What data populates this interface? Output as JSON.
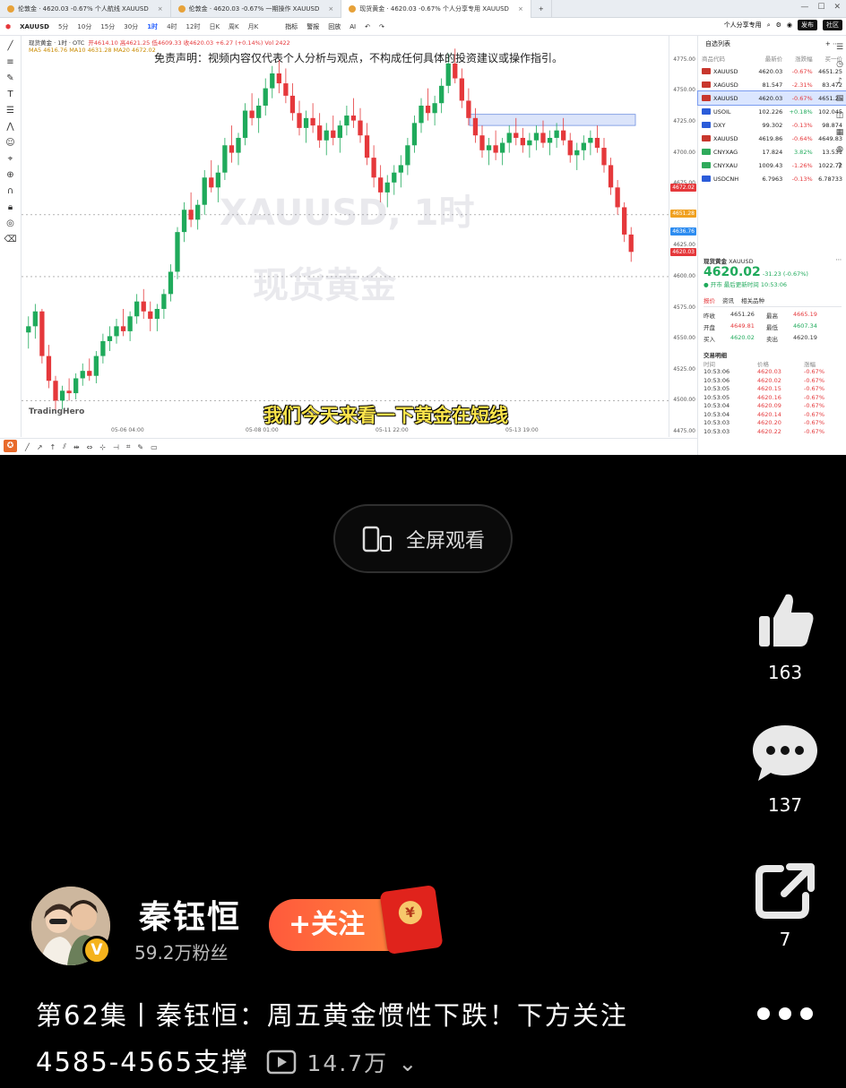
{
  "tabs": [
    {
      "label": "伦敦金 · 4620.03 -0.67% 个人航线 XAUUSD",
      "active": false
    },
    {
      "label": "伦敦金 · 4620.03 -0.67% 一期操作 XAUUSD",
      "active": false
    },
    {
      "label": "现货黄金 · 4620.03 -0.67% 个人分享专用 XAUUSD",
      "active": true
    }
  ],
  "toolbar": {
    "symbol": "XAUUSD",
    "timeframes": [
      "5分",
      "10分",
      "15分",
      "30分",
      "1时",
      "4时",
      "12时",
      "日K",
      "周K",
      "月K"
    ],
    "active_timeframe": "1时",
    "tools": [
      "指标",
      "警报",
      "回放",
      "AI"
    ],
    "right_label": "个人分享专用",
    "btn_publish": "发布",
    "btn_community": "社区"
  },
  "chart": {
    "info_line": "现货黄金 · 1时 · OTC",
    "ohlc": "开4614.10 高4621.25 低4609.33 收4620.03 +6.27 (+0.14%)  Vol 2422",
    "ma_line": "MA5 4616.76  MA10 4631.28  MA20 4672.02",
    "disclaimer": "免责声明：视频内容仅代表个人分析与观点，不构成任何具体的投资建议或操作指引。",
    "watermark_symbol": "XAUUSD, 1时",
    "watermark_name": "现货黄金",
    "logo": "TradingHero",
    "subtitle": "我们今天来看一下黄金在短线",
    "price_ticks": [
      "4775.00",
      "4750.00",
      "4725.00",
      "4700.00",
      "4675.00",
      "4650.00",
      "4625.00",
      "4600.00",
      "4575.00",
      "4550.00",
      "4525.00",
      "4500.00",
      "4475.00"
    ],
    "price_tags": [
      {
        "label": "4672.02",
        "color": "#e5383b"
      },
      {
        "label": "4651.28",
        "color": "#f0a020"
      },
      {
        "label": "4636.76",
        "color": "#2d8cf0"
      },
      {
        "label": "4620.03",
        "color": "#e5383b"
      }
    ],
    "x_labels": [
      "05-06 04:00",
      "05-08 01:00",
      "05-11 22:00",
      "05-13 19:00"
    ],
    "chart_data": {
      "type": "candlestick",
      "series": [
        {
          "name": "XAUUSD",
          "values": [
            [
              4555,
              4568,
              4542,
              4560
            ],
            [
              4560,
              4578,
              4550,
              4572
            ],
            [
              4572,
              4574,
              4530,
              4536
            ],
            [
              4536,
              4545,
              4510,
              4516
            ],
            [
              4516,
              4520,
              4492,
              4500
            ],
            [
              4500,
              4512,
              4493,
              4508
            ],
            [
              4508,
              4518,
              4500,
              4506
            ],
            [
              4506,
              4522,
              4501,
              4518
            ],
            [
              4518,
              4530,
              4512,
              4524
            ],
            [
              4524,
              4534,
              4516,
              4520
            ],
            [
              4520,
              4540,
              4514,
              4536
            ],
            [
              4536,
              4554,
              4530,
              4548
            ],
            [
              4548,
              4560,
              4540,
              4552
            ],
            [
              4552,
              4566,
              4546,
              4560
            ],
            [
              4560,
              4574,
              4552,
              4556
            ],
            [
              4556,
              4572,
              4548,
              4568
            ],
            [
              4568,
              4586,
              4562,
              4580
            ],
            [
              4580,
              4590,
              4566,
              4572
            ],
            [
              4572,
              4580,
              4556,
              4566
            ],
            [
              4566,
              4578,
              4556,
              4574
            ],
            [
              4574,
              4590,
              4566,
              4586
            ],
            [
              4586,
              4610,
              4580,
              4604
            ],
            [
              4604,
              4640,
              4598,
              4636
            ],
            [
              4636,
              4660,
              4628,
              4654
            ],
            [
              4654,
              4668,
              4640,
              4646
            ],
            [
              4646,
              4662,
              4638,
              4658
            ],
            [
              4658,
              4686,
              4650,
              4680
            ],
            [
              4680,
              4694,
              4668,
              4672
            ],
            [
              4672,
              4690,
              4660,
              4684
            ],
            [
              4684,
              4712,
              4678,
              4706
            ],
            [
              4706,
              4722,
              4692,
              4700
            ],
            [
              4700,
              4716,
              4690,
              4712
            ],
            [
              4712,
              4740,
              4706,
              4734
            ],
            [
              4734,
              4748,
              4722,
              4728
            ],
            [
              4728,
              4744,
              4716,
              4738
            ],
            [
              4738,
              4760,
              4730,
              4752
            ],
            [
              4752,
              4770,
              4744,
              4764
            ],
            [
              4764,
              4775,
              4748,
              4756
            ],
            [
              4756,
              4768,
              4740,
              4746
            ],
            [
              4746,
              4756,
              4726,
              4732
            ],
            [
              4732,
              4742,
              4714,
              4720
            ],
            [
              4720,
              4734,
              4708,
              4728
            ],
            [
              4728,
              4740,
              4716,
              4722
            ],
            [
              4722,
              4732,
              4704,
              4710
            ],
            [
              4710,
              4724,
              4698,
              4718
            ],
            [
              4718,
              4730,
              4706,
              4712
            ],
            [
              4712,
              4726,
              4700,
              4722
            ],
            [
              4722,
              4738,
              4714,
              4730
            ],
            [
              4730,
              4744,
              4720,
              4726
            ],
            [
              4726,
              4736,
              4708,
              4714
            ],
            [
              4714,
              4724,
              4690,
              4696
            ],
            [
              4696,
              4706,
              4672,
              4680
            ],
            [
              4680,
              4690,
              4660,
              4668
            ],
            [
              4668,
              4682,
              4656,
              4676
            ],
            [
              4676,
              4690,
              4666,
              4684
            ],
            [
              4684,
              4698,
              4672,
              4690
            ],
            [
              4690,
              4712,
              4682,
              4706
            ],
            [
              4706,
              4730,
              4700,
              4724
            ],
            [
              4724,
              4744,
              4716,
              4738
            ],
            [
              4738,
              4752,
              4726,
              4732
            ],
            [
              4732,
              4746,
              4722,
              4740
            ],
            [
              4740,
              4760,
              4732,
              4754
            ],
            [
              4754,
              4780,
              4748,
              4772
            ],
            [
              4772,
              4784,
              4756,
              4760
            ],
            [
              4760,
              4768,
              4736,
              4742
            ],
            [
              4742,
              4752,
              4722,
              4728
            ],
            [
              4728,
              4736,
              4708,
              4714
            ],
            [
              4714,
              4722,
              4696,
              4702
            ],
            [
              4702,
              4712,
              4690,
              4706
            ],
            [
              4706,
              4718,
              4694,
              4700
            ],
            [
              4700,
              4712,
              4690,
              4708
            ],
            [
              4708,
              4722,
              4700,
              4716
            ],
            [
              4716,
              4728,
              4706,
              4712
            ],
            [
              4712,
              4720,
              4700,
              4706
            ],
            [
              4706,
              4716,
              4696,
              4710
            ],
            [
              4710,
              4722,
              4702,
              4716
            ],
            [
              4716,
              4726,
              4704,
              4708
            ],
            [
              4708,
              4718,
              4698,
              4712
            ],
            [
              4712,
              4724,
              4704,
              4718
            ],
            [
              4718,
              4728,
              4706,
              4710
            ],
            [
              4710,
              4716,
              4692,
              4698
            ],
            [
              4698,
              4708,
              4686,
              4702
            ],
            [
              4702,
              4714,
              4694,
              4708
            ],
            [
              4708,
              4718,
              4698,
              4712
            ],
            [
              4712,
              4722,
              4700,
              4704
            ],
            [
              4704,
              4712,
              4684,
              4690
            ],
            [
              4690,
              4696,
              4666,
              4672
            ],
            [
              4672,
              4678,
              4650,
              4656
            ],
            [
              4656,
              4660,
              4628,
              4634
            ],
            [
              4634,
              4640,
              4612,
              4620
            ]
          ]
        }
      ],
      "ylim": [
        4475,
        4790
      ],
      "zone": [
        4722,
        4731
      ]
    }
  },
  "watchlist": {
    "title": "自选列表",
    "columns": [
      "商品代码",
      "最新价",
      "涨跌幅",
      "买一价"
    ],
    "rows": [
      {
        "code": "XAUUSD",
        "price": "4620.03",
        "chg": "-0.67%",
        "bid": "4651.25",
        "flag": "#c8372d",
        "neg": true,
        "sel": false
      },
      {
        "code": "XAGUSD",
        "price": "81.547",
        "chg": "-2.31%",
        "bid": "83.472",
        "flag": "#c8372d",
        "neg": true,
        "sel": false
      },
      {
        "code": "XAUUSD",
        "price": "4620.03",
        "chg": "-0.67%",
        "bid": "4651.25",
        "flag": "#c8372d",
        "neg": true,
        "sel": true
      },
      {
        "code": "USOIL",
        "price": "102.226",
        "chg": "+0.18%",
        "bid": "102.045",
        "flag": "#2b5cd9",
        "neg": false,
        "sel": false
      },
      {
        "code": "DXY",
        "price": "99.302",
        "chg": "-0.13%",
        "bid": "98.874",
        "flag": "#2b5cd9",
        "neg": true,
        "sel": false
      },
      {
        "code": "XAUUSD",
        "price": "4619.86",
        "chg": "-0.64%",
        "bid": "4649.83",
        "flag": "#c8372d",
        "neg": true,
        "sel": false
      },
      {
        "code": "CNYXAG",
        "price": "17.824",
        "chg": "3.82%",
        "bid": "13.531",
        "flag": "#2faa5b",
        "neg": false,
        "sel": false
      },
      {
        "code": "CNYXAU",
        "price": "1009.43",
        "chg": "-1.26%",
        "bid": "1022.72",
        "flag": "#2faa5b",
        "neg": true,
        "sel": false
      },
      {
        "code": "USDCNH",
        "price": "6.7963",
        "chg": "-0.13%",
        "bid": "6.78733",
        "flag": "#2b5cd9",
        "neg": true,
        "sel": false
      }
    ]
  },
  "quote": {
    "name": "现货黄金",
    "code": "XAUUSD",
    "price": "4620.02",
    "change": "-31.23 (-0.67%)",
    "status": "● 开市 最后更新时间 10:53:06",
    "tabs": [
      "报价",
      "资讯",
      "相关品种"
    ],
    "fields": [
      {
        "k": "昨收",
        "v": "4651.26"
      },
      {
        "k": "最高",
        "v": "4665.19"
      },
      {
        "k": "开盘",
        "v": "4649.81"
      },
      {
        "k": "最低",
        "v": "4607.34"
      },
      {
        "k": "买入",
        "v": "4620.02"
      },
      {
        "k": "卖出",
        "v": "4620.19"
      }
    ],
    "ticks_title": "交易明细",
    "ticks_cols": [
      "时间",
      "价格",
      "涨幅"
    ],
    "ticks": [
      {
        "t": "10:53:06",
        "p": "4620.03",
        "c": "-0.67%"
      },
      {
        "t": "10:53:06",
        "p": "4620.02",
        "c": "-0.67%"
      },
      {
        "t": "10:53:05",
        "p": "4620.15",
        "c": "-0.67%"
      },
      {
        "t": "10:53:05",
        "p": "4620.16",
        "c": "-0.67%"
      },
      {
        "t": "10:53:04",
        "p": "4620.09",
        "c": "-0.67%"
      },
      {
        "t": "10:53:04",
        "p": "4620.14",
        "c": "-0.67%"
      },
      {
        "t": "10:53:03",
        "p": "4620.20",
        "c": "-0.67%"
      },
      {
        "t": "10:53:03",
        "p": "4620.22",
        "c": "-0.67%"
      }
    ]
  },
  "overlay": {
    "fullscreen_label": "全屏观看",
    "likes": "163",
    "comments": "137",
    "shares": "7",
    "username": "秦钰恒",
    "fans": "59.2万粉丝",
    "follow_label": "+关注",
    "description": "第62集丨秦钰恒：周五黄金惯性下跌！下方关注4585-4565支撑",
    "views": "14.7万"
  }
}
